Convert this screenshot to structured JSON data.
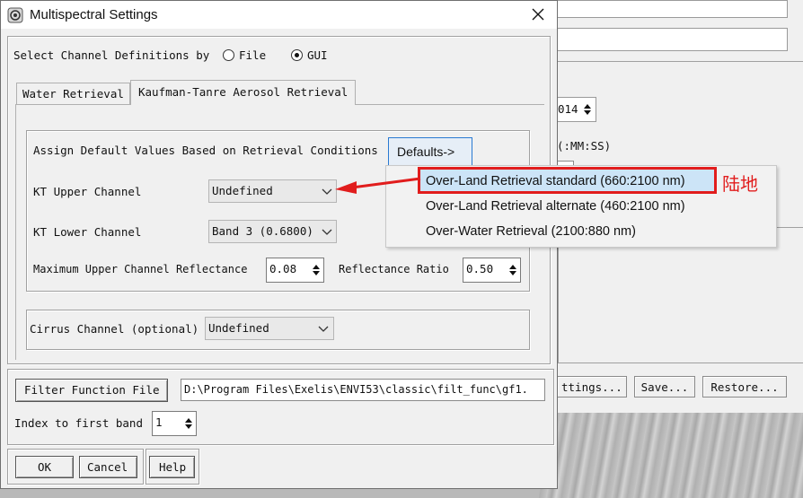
{
  "dialog": {
    "title": "Multispectral Settings",
    "select_channel_label": "Select Channel Definitions by",
    "radio_file_label": "File",
    "radio_gui_label": "GUI",
    "selected_radio": "GUI"
  },
  "tabs": [
    {
      "label": "Water Retrieval",
      "active": false
    },
    {
      "label": "Kaufman-Tanre Aerosol Retrieval",
      "active": true
    }
  ],
  "kt": {
    "assign_label": "Assign Default Values Based on Retrieval Conditions",
    "defaults_button": "Defaults->",
    "upper_label": "KT Upper Channel",
    "upper_value": "Undefined",
    "lower_label": "KT Lower Channel",
    "lower_value": "Band 3 (0.6800)",
    "max_refl_label": "Maximum Upper Channel Reflectance",
    "max_refl_value": "0.08",
    "ratio_label": "Reflectance Ratio",
    "ratio_value": "0.50",
    "cirrus_label": "Cirrus Channel (optional)",
    "cirrus_value": "Undefined"
  },
  "filter": {
    "button": "Filter Function File",
    "path": "D:\\Program Files\\Exelis\\ENVI53\\classic\\filt_func\\gf1.",
    "index_label": "Index to first band",
    "index_value": "1"
  },
  "footer": {
    "ok": "OK",
    "cancel": "Cancel",
    "help": "Help"
  },
  "defaults_menu": {
    "items": [
      "Over-Land Retrieval standard (660:2100 nm)",
      "Over-Land Retrieval alternate (460:2100 nm)",
      "Over-Water Retrieval (2100:880 nm)"
    ],
    "highlighted_index": 0
  },
  "annotation": {
    "text": "陆地",
    "color": "#e11d1d"
  },
  "background_window": {
    "year_fragment": "014",
    "time_format": "(:MM:SS)",
    "settings_button": "ttings...",
    "save_button": "Save...",
    "restore_button": "Restore..."
  }
}
